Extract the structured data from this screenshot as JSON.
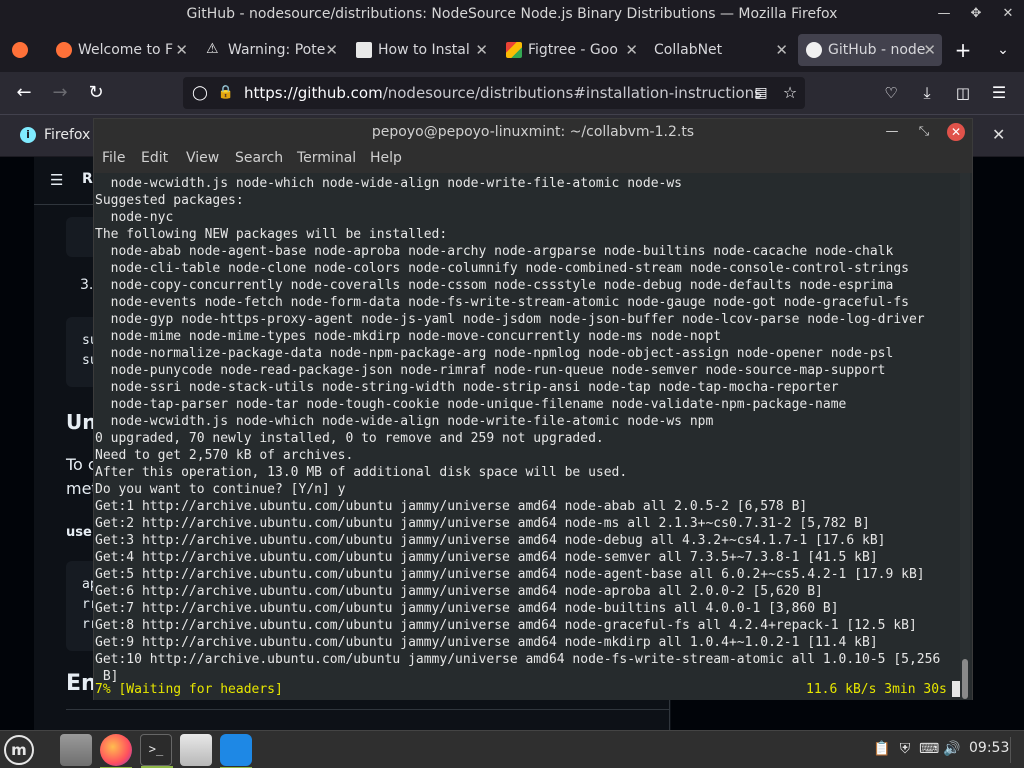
{
  "firefox": {
    "window_title": "GitHub - nodesource/distributions: NodeSource Node.js Binary Distributions — Mozilla Firefox",
    "tabs": [
      {
        "label": "Welcome to F",
        "icon": "firefox-icon",
        "active": false
      },
      {
        "label": "Warning: Pote",
        "icon": "warning-icon",
        "active": false
      },
      {
        "label": "How to Instal",
        "icon": "site-icon",
        "active": false
      },
      {
        "label": "Figtree - Goo",
        "icon": "google-fonts-icon",
        "active": false
      },
      {
        "label": "CollabNet",
        "icon": "",
        "active": false
      },
      {
        "label": "GitHub - node",
        "icon": "github-icon",
        "active": true
      }
    ],
    "url_host": "https://github.com",
    "url_path": "/nodesource/distributions#installation-instructions",
    "notification": "Firefox",
    "notification_icon": "i"
  },
  "github_page": {
    "toc_label": "R",
    "list_number": "3.",
    "code_snippet_1": [
      "su",
      "su"
    ],
    "heading_1": "Un",
    "paragraph_1": [
      "To c",
      "met"
    ],
    "bold_label": "use",
    "code_snippet_2": [
      "ap",
      "rr",
      "rr"
    ],
    "heading_2": "En"
  },
  "terminal": {
    "title": "pepoyo@pepoyo-linuxmint: ~/collabvm-1.2.ts",
    "menu": [
      "File",
      "Edit",
      "View",
      "Search",
      "Terminal",
      "Help"
    ],
    "lines": [
      "  node-wcwidth.js node-which node-wide-align node-write-file-atomic node-ws",
      "Suggested packages:",
      "  node-nyc",
      "The following NEW packages will be installed:",
      "  node-abab node-agent-base node-aproba node-archy node-argparse node-builtins node-cacache node-chalk",
      "  node-cli-table node-clone node-colors node-columnify node-combined-stream node-console-control-strings",
      "  node-copy-concurrently node-coveralls node-cssom node-cssstyle node-debug node-defaults node-esprima",
      "  node-events node-fetch node-form-data node-fs-write-stream-atomic node-gauge node-got node-graceful-fs",
      "  node-gyp node-https-proxy-agent node-js-yaml node-jsdom node-json-buffer node-lcov-parse node-log-driver",
      "  node-mime node-mime-types node-mkdirp node-move-concurrently node-ms node-nopt",
      "  node-normalize-package-data node-npm-package-arg node-npmlog node-object-assign node-opener node-psl",
      "  node-punycode node-read-package-json node-rimraf node-run-queue node-semver node-source-map-support",
      "  node-ssri node-stack-utils node-string-width node-strip-ansi node-tap node-tap-mocha-reporter",
      "  node-tap-parser node-tar node-tough-cookie node-unique-filename node-validate-npm-package-name",
      "  node-wcwidth.js node-which node-wide-align node-write-file-atomic node-ws npm",
      "0 upgraded, 70 newly installed, 0 to remove and 259 not upgraded.",
      "Need to get 2,570 kB of archives.",
      "After this operation, 13.0 MB of additional disk space will be used.",
      "Do you want to continue? [Y/n] y",
      "Get:1 http://archive.ubuntu.com/ubuntu jammy/universe amd64 node-abab all 2.0.5-2 [6,578 B]",
      "Get:2 http://archive.ubuntu.com/ubuntu jammy/universe amd64 node-ms all 2.1.3+~cs0.7.31-2 [5,782 B]",
      "Get:3 http://archive.ubuntu.com/ubuntu jammy/universe amd64 node-debug all 4.3.2+~cs4.1.7-1 [17.6 kB]",
      "Get:4 http://archive.ubuntu.com/ubuntu jammy/universe amd64 node-semver all 7.3.5+~7.3.8-1 [41.5 kB]",
      "Get:5 http://archive.ubuntu.com/ubuntu jammy/universe amd64 node-agent-base all 6.0.2+~cs5.4.2-1 [17.9 kB]",
      "Get:6 http://archive.ubuntu.com/ubuntu jammy/universe amd64 node-aproba all 2.0.0-2 [5,620 B]",
      "Get:7 http://archive.ubuntu.com/ubuntu jammy/universe amd64 node-builtins all 4.0.0-1 [3,860 B]",
      "Get:8 http://archive.ubuntu.com/ubuntu jammy/universe amd64 node-graceful-fs all 4.2.4+repack-1 [12.5 kB]",
      "Get:9 http://archive.ubuntu.com/ubuntu jammy/universe amd64 node-mkdirp all 1.0.4+~1.0.2-1 [11.4 kB]",
      "Get:10 http://archive.ubuntu.com/ubuntu jammy/universe amd64 node-fs-write-stream-atomic all 1.0.10-5 [5,256",
      " B]"
    ],
    "status_left": "7% [Waiting for headers]",
    "status_right": "11.6 kB/s 3min 30s"
  },
  "taskbar": {
    "apps": [
      "file-manager-icon",
      "firefox-icon",
      "terminal-icon",
      "software-manager-icon",
      "collabvm-icon"
    ],
    "clock": "09:53"
  }
}
